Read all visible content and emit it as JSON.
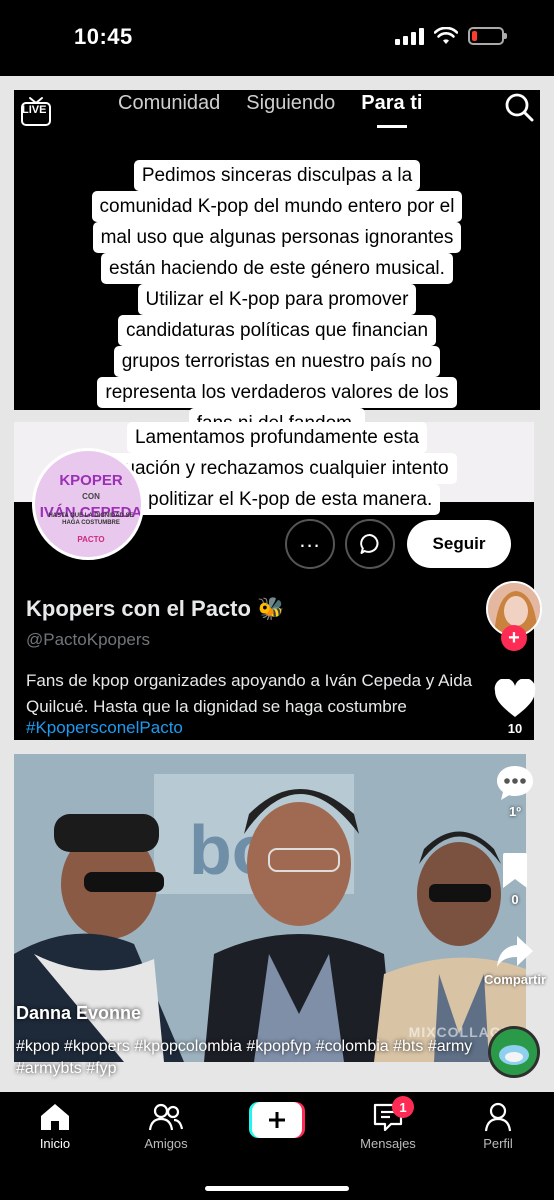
{
  "status_bar": {
    "time": "10:45"
  },
  "top_nav": {
    "live_label": "LIVE",
    "tabs": [
      {
        "label": "Comunidad"
      },
      {
        "label": "Siguiendo"
      },
      {
        "label": "Para ti"
      }
    ]
  },
  "caption_top": [
    "Pedimos sinceras disculpas a la",
    "comunidad K-pop del mundo entero por el",
    "mal uso que algunas personas ignorantes",
    "están haciendo de este género musical.",
    "Utilizar el K-pop para promover",
    "candidaturas políticas que financian",
    "grupos terroristas en nuestro país no",
    "representa los verdaderos valores de los",
    "fans ni del fandom."
  ],
  "caption_bottom": [
    "Lamentamos profundamente esta",
    "situación y rechazamos cualquier intento",
    "de politizar el K-pop de esta manera."
  ],
  "profile_card": {
    "logo_title_1": "KPOPER",
    "logo_con": "CON",
    "logo_title_2": "IVÁN CEPEDA",
    "logo_subtitle": "HASTA QUE LA DIGNIDAD SE HAGA COSTUMBRE",
    "logo_brand": "PACTO",
    "follow_label": "Seguir",
    "name": "Kpopers con el Pacto 🐝",
    "handle": "@PactoKpopers",
    "bio": "Fans de kpop organizades apoyando a Iván Cepeda y Aida Quilcué. Hasta que la dignidad se haga costumbre",
    "hashtag": "#KpopersconelPacto"
  },
  "photo": {
    "watermark": "MIXCOLLAGE"
  },
  "right_rail": {
    "likes": "10",
    "comments": "1º",
    "saves": "0",
    "share_label": "Compartir"
  },
  "post": {
    "username": "Danna Evonne",
    "hashtags": "#kpop #kpopers #kpopcolombia #kpopfyp #colombia #bts #army #armybts #fyp"
  },
  "bottom_nav": {
    "items": [
      {
        "label": "Inicio"
      },
      {
        "label": "Amigos"
      },
      {
        "label": "Mensajes"
      },
      {
        "label": "Perfil"
      }
    ],
    "messages_badge": "1"
  },
  "colors": {
    "accent_red": "#fe2c55",
    "link_blue": "#1d9bf0",
    "logo_purple": "#9b2fb5"
  }
}
